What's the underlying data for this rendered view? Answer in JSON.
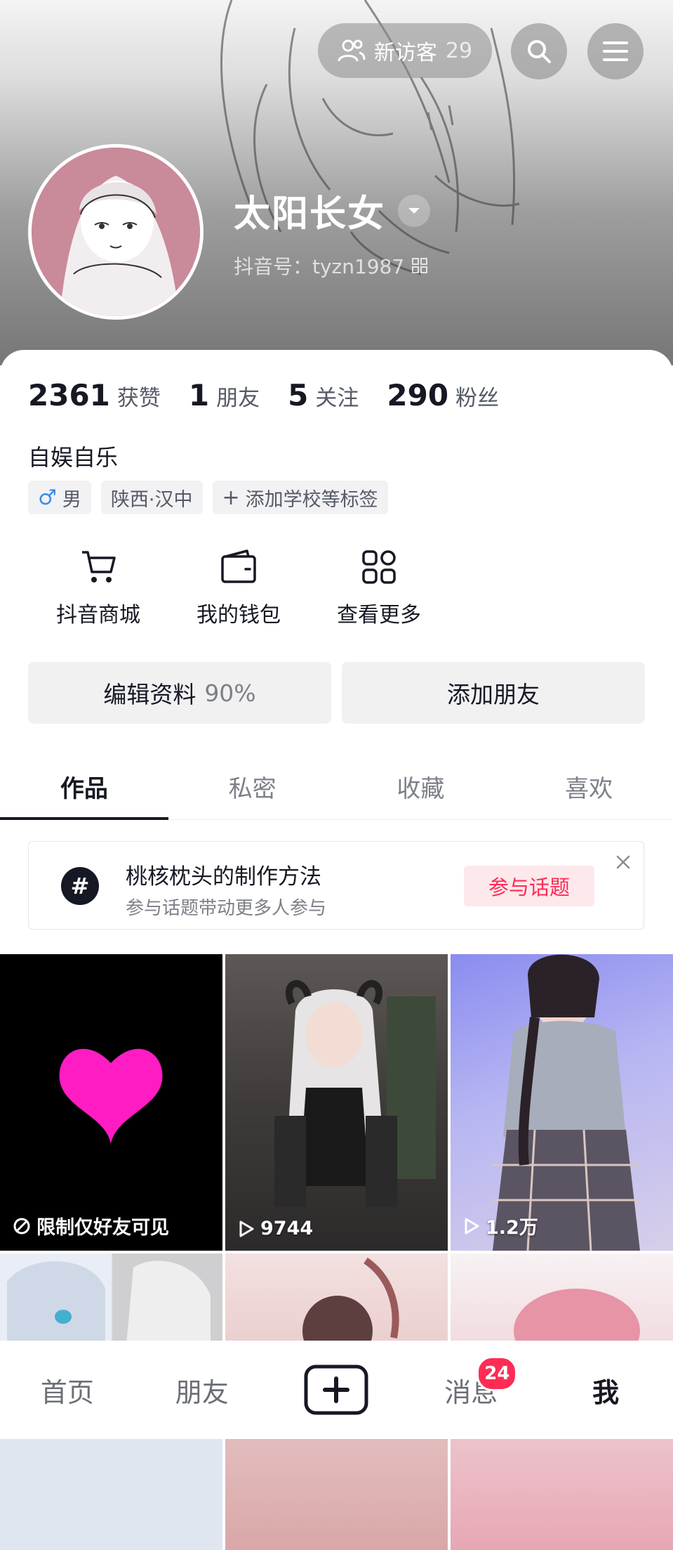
{
  "header": {
    "visitors_label": "新访客",
    "visitors_count": "29",
    "name": "太阳长女",
    "douyin_id": "抖音号：tyzn1987"
  },
  "stats": [
    {
      "value": "2361",
      "label": "获赞"
    },
    {
      "value": "1",
      "label": "朋友"
    },
    {
      "value": "5",
      "label": "关注"
    },
    {
      "value": "290",
      "label": "粉丝"
    }
  ],
  "bio": "自娱自乐",
  "tags": {
    "gender": "男",
    "location": "陕西·汉中",
    "add_tag": "添加学校等标签"
  },
  "shortcuts": [
    {
      "label": "抖音商城",
      "icon": "cart-icon"
    },
    {
      "label": "我的钱包",
      "icon": "wallet-icon"
    },
    {
      "label": "查看更多",
      "icon": "grid-icon"
    }
  ],
  "buttons": {
    "edit_profile": "编辑资料",
    "edit_percent": "90%",
    "add_friend": "添加朋友"
  },
  "tabs": [
    {
      "label": "作品",
      "active": true
    },
    {
      "label": "私密",
      "active": false
    },
    {
      "label": "收藏",
      "active": false
    },
    {
      "label": "喜欢",
      "active": false
    }
  ],
  "topic": {
    "title": "桃核枕头的制作方法",
    "subtitle": "参与话题带动更多人参与",
    "join": "参与话题"
  },
  "videos": [
    {
      "label": "限制仅好友可见",
      "icon": "restricted-icon"
    },
    {
      "label": "9744",
      "icon": "play-icon"
    },
    {
      "label": "1.2万",
      "icon": "play-icon"
    },
    {
      "label": "",
      "icon": ""
    },
    {
      "label": "",
      "icon": ""
    },
    {
      "label": "",
      "icon": ""
    }
  ],
  "nav": {
    "home": "首页",
    "friends": "朋友",
    "messages": "消息",
    "messages_badge": "24",
    "me": "我"
  },
  "colors": {
    "accent": "#fe2c55",
    "text": "#161823",
    "secondary": "#7d8088"
  }
}
